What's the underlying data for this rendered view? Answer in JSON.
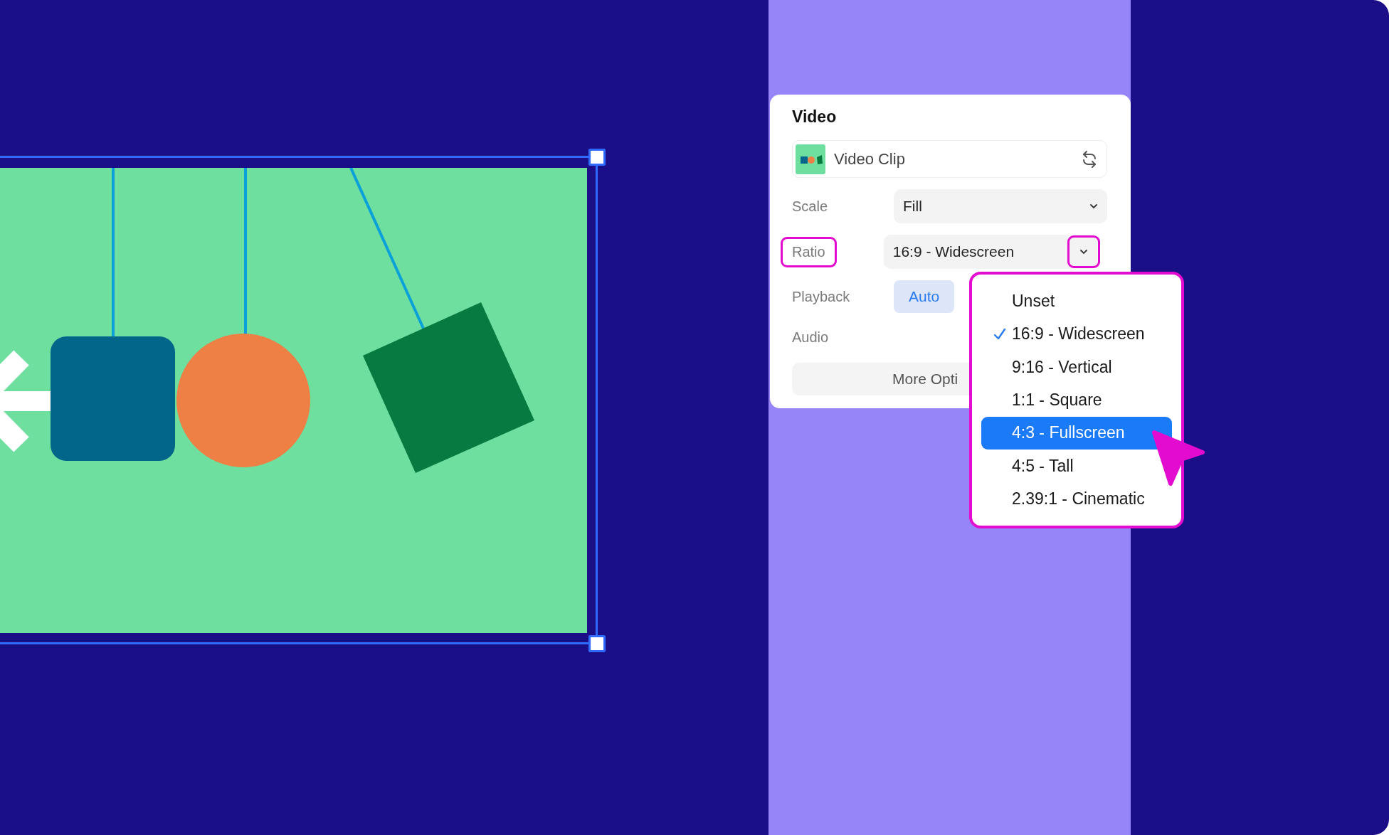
{
  "panel": {
    "title": "Video",
    "clip": {
      "name": "Video Clip"
    },
    "rows": [
      {
        "kind": "select",
        "label": "Scale",
        "value": "Fill",
        "annotated": false
      },
      {
        "kind": "select",
        "label": "Ratio",
        "value": "16:9 - Widescreen",
        "annotated": true
      },
      {
        "kind": "segmented",
        "label": "Playback",
        "segments": [
          {
            "label": "Auto",
            "selected": true
          }
        ]
      },
      {
        "kind": "plain",
        "label": "Audio"
      }
    ],
    "more_button": "More Opti"
  },
  "ratio_menu": {
    "options": [
      {
        "label": "Unset",
        "checked": false,
        "selected": false
      },
      {
        "label": "16:9 - Widescreen",
        "checked": true,
        "selected": false
      },
      {
        "label": "9:16 - Vertical",
        "checked": false,
        "selected": false
      },
      {
        "label": "1:1 - Square",
        "checked": false,
        "selected": false
      },
      {
        "label": "4:3 - Fullscreen",
        "checked": false,
        "selected": true
      },
      {
        "label": "4:5 - Tall",
        "checked": false,
        "selected": false
      },
      {
        "label": "2.39:1 - Cinematic",
        "checked": false,
        "selected": false
      }
    ]
  }
}
